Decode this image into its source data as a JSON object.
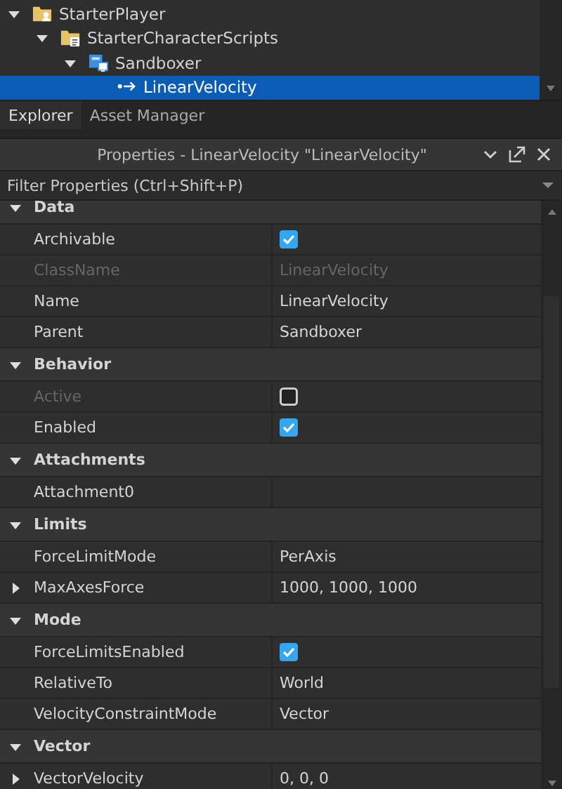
{
  "explorer": {
    "items": [
      {
        "name": "StarterPlayer",
        "kind": "player-folder",
        "expanded": true,
        "selected": false,
        "children": [
          {
            "name": "StarterCharacterScripts",
            "kind": "script-folder",
            "expanded": true,
            "selected": false,
            "children": [
              {
                "name": "Sandboxer",
                "kind": "model",
                "expanded": true,
                "selected": false,
                "children": [
                  {
                    "name": "LinearVelocity",
                    "kind": "velocity",
                    "selected": true
                  }
                ]
              }
            ]
          }
        ]
      }
    ]
  },
  "tabs": [
    {
      "label": "Explorer",
      "selected": true
    },
    {
      "label": "Asset Manager",
      "selected": false
    }
  ],
  "properties": {
    "title": "Properties - LinearVelocity \"LinearVelocity\"",
    "filter": {
      "placeholder": "Filter Properties (Ctrl+Shift+P)"
    },
    "categories": [
      {
        "name": "Data",
        "expanded": true,
        "properties": [
          {
            "name": "Archivable",
            "kind": "checkbox",
            "checked": true,
            "disabled": false
          },
          {
            "name": "ClassName",
            "kind": "text",
            "value": "LinearVelocity",
            "disabled": true
          },
          {
            "name": "Name",
            "kind": "text",
            "value": "LinearVelocity",
            "disabled": false
          },
          {
            "name": "Parent",
            "kind": "text",
            "value": "Sandboxer",
            "disabled": false
          }
        ]
      },
      {
        "name": "Behavior",
        "expanded": true,
        "properties": [
          {
            "name": "Active",
            "kind": "checkbox",
            "checked": false,
            "disabled": true
          },
          {
            "name": "Enabled",
            "kind": "checkbox",
            "checked": true,
            "disabled": false
          }
        ]
      },
      {
        "name": "Attachments",
        "expanded": true,
        "properties": [
          {
            "name": "Attachment0",
            "kind": "text",
            "disabled": false
          }
        ]
      },
      {
        "name": "Limits",
        "expanded": true,
        "properties": [
          {
            "name": "ForceLimitMode",
            "kind": "text",
            "value": "PerAxis",
            "disabled": false
          },
          {
            "name": "MaxAxesForce",
            "kind": "text",
            "value": "1000, 1000, 1000",
            "disabled": false,
            "expanded": false
          }
        ]
      },
      {
        "name": "Mode",
        "expanded": true,
        "properties": [
          {
            "name": "ForceLimitsEnabled",
            "kind": "checkbox",
            "checked": true,
            "disabled": false
          },
          {
            "name": "RelativeTo",
            "kind": "text",
            "value": "World",
            "disabled": false
          },
          {
            "name": "VelocityConstraintMode",
            "kind": "text",
            "value": "Vector",
            "disabled": false
          }
        ]
      },
      {
        "name": "Vector",
        "expanded": true,
        "properties": [
          {
            "name": "VectorVelocity",
            "kind": "text",
            "value": "0, 0, 0",
            "disabled": false,
            "expanded": false
          }
        ]
      }
    ]
  }
}
